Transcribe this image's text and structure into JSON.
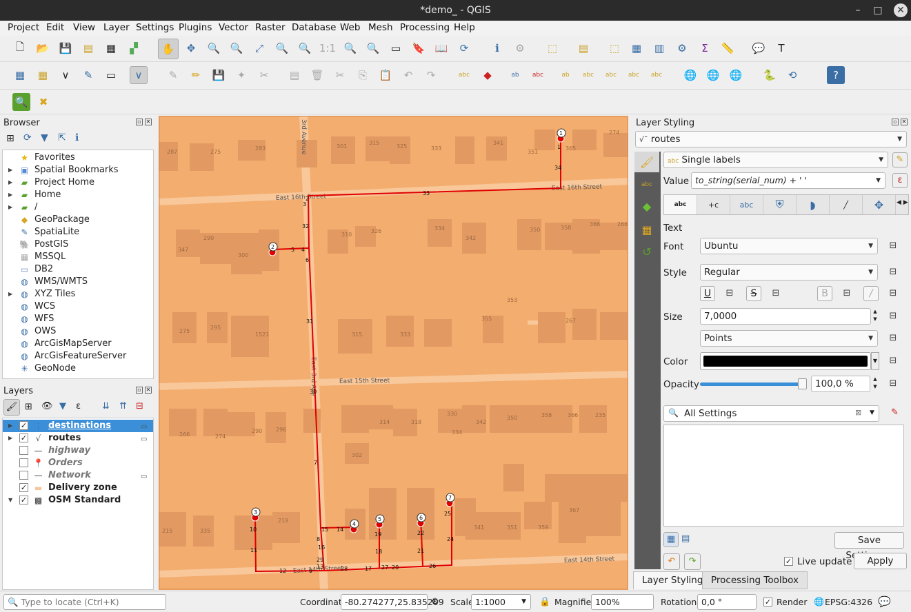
{
  "window": {
    "title": "*demo_ - QGIS"
  },
  "menu": [
    "Project",
    "Edit",
    "View",
    "Layer",
    "Settings",
    "Plugins",
    "Vector",
    "Raster",
    "Database",
    "Web",
    "Mesh",
    "Processing",
    "Help"
  ],
  "browser": {
    "title": "Browser",
    "items": [
      {
        "label": "Favorites",
        "icon": "star-icon",
        "arrow": false
      },
      {
        "label": "Spatial Bookmarks",
        "icon": "bookmark-icon",
        "arrow": true
      },
      {
        "label": "Project Home",
        "icon": "folder-icon",
        "arrow": true
      },
      {
        "label": "Home",
        "icon": "folder-icon",
        "arrow": true
      },
      {
        "label": "/",
        "icon": "folder-icon",
        "arrow": true
      },
      {
        "label": "GeoPackage",
        "icon": "geopackage-icon",
        "arrow": false
      },
      {
        "label": "SpatiaLite",
        "icon": "spatialite-icon",
        "arrow": false
      },
      {
        "label": "PostGIS",
        "icon": "postgis-icon",
        "arrow": false
      },
      {
        "label": "MSSQL",
        "icon": "mssql-icon",
        "arrow": false
      },
      {
        "label": "DB2",
        "icon": "db2-icon",
        "arrow": false
      },
      {
        "label": "WMS/WMTS",
        "icon": "globe-icon",
        "arrow": false
      },
      {
        "label": "XYZ Tiles",
        "icon": "globe-icon",
        "arrow": true
      },
      {
        "label": "WCS",
        "icon": "globe-icon",
        "arrow": false
      },
      {
        "label": "WFS",
        "icon": "globe-icon",
        "arrow": false
      },
      {
        "label": "OWS",
        "icon": "globe-icon",
        "arrow": false
      },
      {
        "label": "ArcGisMapServer",
        "icon": "globe-icon",
        "arrow": false
      },
      {
        "label": "ArcGisFeatureServer",
        "icon": "globe-icon",
        "arrow": false
      },
      {
        "label": "GeoNode",
        "icon": "geonode-icon",
        "arrow": false
      }
    ]
  },
  "layers": {
    "title": "Layers",
    "items": [
      {
        "label": "destinations",
        "checked": true,
        "arrow": "right",
        "bold": true,
        "italic": false
      },
      {
        "label": "routes",
        "checked": true,
        "arrow": "right",
        "bold": true,
        "italic": false
      },
      {
        "label": "highway",
        "checked": false,
        "arrow": "",
        "bold": true,
        "italic": true
      },
      {
        "label": "Orders",
        "checked": false,
        "arrow": "",
        "bold": true,
        "italic": true
      },
      {
        "label": "Network",
        "checked": false,
        "arrow": "",
        "bold": true,
        "italic": true
      },
      {
        "label": "Delivery zone",
        "checked": true,
        "arrow": "",
        "bold": true,
        "italic": false
      },
      {
        "label": "OSM Standard",
        "checked": true,
        "arrow": "down",
        "bold": true,
        "italic": false
      }
    ]
  },
  "map": {
    "streets": [
      "East 16th Street",
      "East 16th Street",
      "East 15th Street",
      "East 14th Street",
      "East 14th Street",
      "3rd Avenue",
      "East 3rd Ave"
    ],
    "house_numbers": [
      "287",
      "275",
      "283",
      "301",
      "315",
      "325",
      "333",
      "341",
      "351",
      "365",
      "274",
      "290",
      "300",
      "310",
      "326",
      "334",
      "342",
      "350",
      "358",
      "366",
      "266",
      "347",
      "353",
      "355",
      "267",
      "275",
      "295",
      "1521",
      "315",
      "333",
      "266",
      "274",
      "290",
      "296",
      "302",
      "314",
      "318",
      "330",
      "334",
      "342",
      "350",
      "358",
      "366",
      "235",
      "219",
      "215",
      "335",
      "341",
      "351",
      "359",
      "367"
    ],
    "route_labels": [
      "1",
      "34",
      "33",
      "2",
      "3",
      "32",
      "5",
      "4",
      "6",
      "31",
      "30",
      "7",
      "8",
      "16",
      "15",
      "14",
      "29",
      "13",
      "9",
      "12",
      "11",
      "10",
      "28",
      "17",
      "27",
      "20",
      "26",
      "19",
      "18",
      "22",
      "21",
      "25",
      "24"
    ],
    "markers": [
      "1",
      "2",
      "3",
      "4",
      "5",
      "6",
      "7"
    ]
  },
  "styling": {
    "title": "Layer Styling",
    "layer": "routes",
    "mode": "Single labels",
    "value_label": "Value",
    "value_expr": "to_string(serial_num) + '  '",
    "section": "Text",
    "font_label": "Font",
    "font": "Ubuntu",
    "style_label": "Style",
    "style": "Regular",
    "size_label": "Size",
    "size": "7,0000",
    "unit": "Points",
    "color_label": "Color",
    "color": "#000000",
    "opacity_label": "Opacity",
    "opacity": "100,0 %",
    "opacity_fraction": 1.0,
    "search_placeholder": "All Settings",
    "save_settings": "Save Settings...",
    "live_update": "Live update",
    "apply": "Apply",
    "tab_text_abc": "abc"
  },
  "bottom_tabs": [
    "Layer Styling",
    "Processing Toolbox"
  ],
  "status": {
    "locate_placeholder": "Type to locate (Ctrl+K)",
    "coordinate_label": "Coordinate",
    "coordinate": "-80.274277,25.835209",
    "scale_label": "Scale",
    "scale": "1:1000",
    "magnifier_label": "Magnifier",
    "magnifier": "100%",
    "rotation_label": "Rotation",
    "rotation": "0,0 °",
    "render_label": "Render",
    "crs": "EPSG:4326"
  },
  "colors": {
    "zone": "#f3ad6e",
    "building": "#e29962",
    "route": "#e00000",
    "selection": "#3b8fd8"
  }
}
